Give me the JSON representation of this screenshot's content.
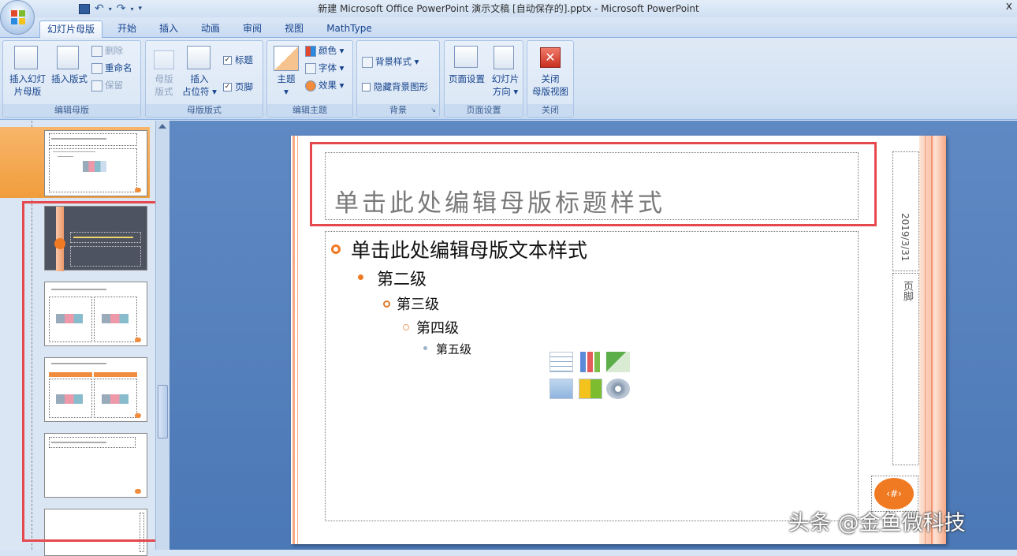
{
  "window": {
    "title": "新建 Microsoft Office PowerPoint 演示文稿 [自动保存的].pptx - Microsoft PowerPoint",
    "close_glyph": "x"
  },
  "tabs": [
    "幻灯片母版",
    "开始",
    "插入",
    "动画",
    "审阅",
    "视图",
    "MathType"
  ],
  "ribbon": {
    "groups": {
      "edit_master": "编辑母版",
      "master_layout": "母版版式",
      "edit_theme": "编辑主题",
      "background": "背景",
      "page_setup": "页面设置",
      "close": "关闭"
    },
    "insert_master_line1": "插入幻灯",
    "insert_master_line2": "片母版",
    "insert_layout": "插入版式",
    "delete": "删除",
    "rename": "重命名",
    "preserve": "保留",
    "master_layout_line1": "母版",
    "master_layout_line2": "版式",
    "insert_placeholder_line1": "插入",
    "insert_placeholder_line2": "占位符",
    "title_check": "标题",
    "footer_check": "页脚",
    "themes": "主题",
    "colors": "颜色",
    "fonts": "字体",
    "effects": "效果",
    "background_styles": "背景样式",
    "hide_background": "隐藏背景图形",
    "page_setup": "页面设置",
    "orientation_line1": "幻灯片",
    "orientation_line2": "方向",
    "close_line1": "关闭",
    "close_line2": "母版视图"
  },
  "slide": {
    "title_placeholder": "单击此处编辑母版标题样式",
    "level1": "单击此处编辑母版文本样式",
    "level2": "第二级",
    "level3": "第三级",
    "level4": "第四级",
    "level5": "第五级",
    "date": "2019/3/31",
    "footer": "页脚",
    "slide_number": "‹#›"
  },
  "colors": {
    "accent_orange": "#f07a22",
    "highlight_red": "#e5484d",
    "selected_thumb": "#f19d3d"
  },
  "watermark": "头条 @金鱼微科技"
}
